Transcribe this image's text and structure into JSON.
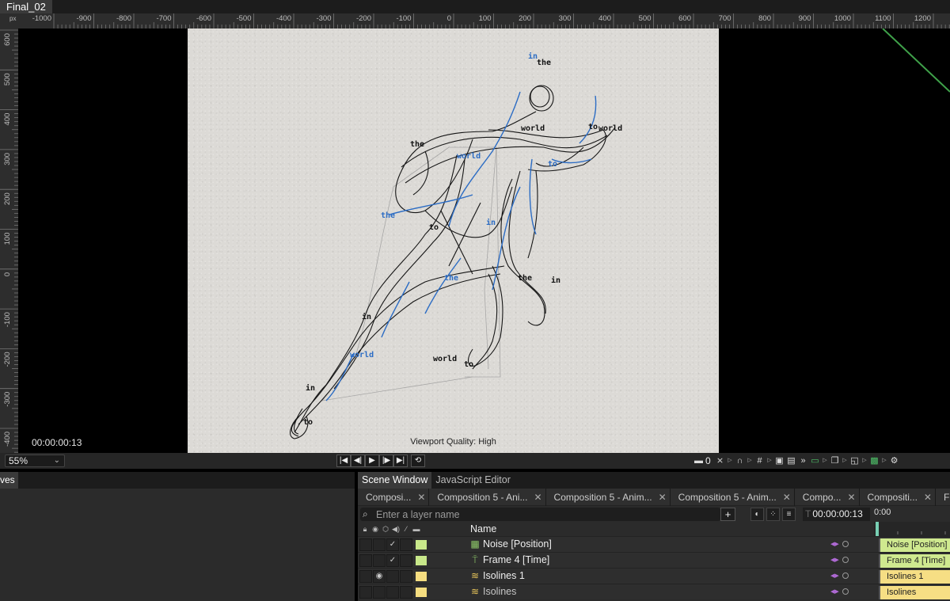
{
  "window": {
    "title": "Final_02"
  },
  "ruler": {
    "unit": "px",
    "x_labels": [
      "-1000",
      "-900",
      "-800",
      "-700",
      "-600",
      "-500",
      "-400",
      "-300",
      "-200",
      "-100",
      "0",
      "100",
      "200",
      "300",
      "400",
      "500",
      "600",
      "700",
      "800",
      "900",
      "1000",
      "1100",
      "1200"
    ],
    "y_labels": [
      "600",
      "500",
      "400",
      "300",
      "200",
      "100",
      "0",
      "-100",
      "-200",
      "-300",
      "-400"
    ]
  },
  "viewport": {
    "timecode": "00:00:00:13",
    "quality": "Viewport Quality: High",
    "words": [
      {
        "text": "in",
        "blue": true
      },
      {
        "text": "the",
        "blue": false
      },
      {
        "text": "world",
        "blue": false
      },
      {
        "text": "to",
        "blue": false
      },
      {
        "text": "world",
        "blue": false
      },
      {
        "text": "the",
        "blue": false
      },
      {
        "text": "world",
        "blue": true
      },
      {
        "text": "to",
        "blue": true
      },
      {
        "text": "the",
        "blue": true
      },
      {
        "text": "to",
        "blue": false
      },
      {
        "text": "in",
        "blue": true
      },
      {
        "text": "the",
        "blue": true
      },
      {
        "text": "the",
        "blue": false
      },
      {
        "text": "in",
        "blue": false
      },
      {
        "text": "in",
        "blue": false
      },
      {
        "text": "world",
        "blue": true
      },
      {
        "text": "world",
        "blue": false
      },
      {
        "text": "to",
        "blue": false
      },
      {
        "text": "in",
        "blue": false
      },
      {
        "text": "to",
        "blue": false
      }
    ]
  },
  "toolbar": {
    "zoom": "55%",
    "counter": "0"
  },
  "left_panel": {
    "tab": "ves"
  },
  "panel_tabs": [
    "Scene Window",
    "JavaScript Editor"
  ],
  "comp_tabs": [
    "Composi...",
    "Composition 5 - Ani...",
    "Composition 5 - Anim...",
    "Composition 5 - Anim...",
    "Compo...",
    "Compositi...",
    "F"
  ],
  "layers_panel": {
    "search_placeholder": "Enter a layer name",
    "time": "00:00:00:13",
    "time_prefix": "T",
    "timeline_start": "0:00",
    "name_header": "Name",
    "layers": [
      {
        "name": "Noise [Position]",
        "bar": "Noise [Position]",
        "chip": "#c8e88a",
        "bar_color": "#cfe98f",
        "icon": "noise-icon",
        "icon_glyph": "▦",
        "icon_color": "#8fca6a",
        "checked": true,
        "visible": false
      },
      {
        "name": "Frame 4 [Time]",
        "bar": "Frame 4 [Time]",
        "chip": "#c8e88a",
        "bar_color": "#cfe98f",
        "icon": "frame-icon",
        "icon_glyph": "⍑",
        "icon_color": "#8fca6a",
        "checked": true,
        "visible": false
      },
      {
        "name": "Isolines 1",
        "bar": "Isolines 1",
        "chip": "#f5dd80",
        "bar_color": "#f6de84",
        "icon": "isolines-icon",
        "icon_glyph": "≋",
        "icon_color": "#e6c45a",
        "checked": false,
        "visible": true
      },
      {
        "name": "Isolines",
        "bar": "Isolines",
        "chip": "#f5dd80",
        "bar_color": "#f6de84",
        "icon": "isolines-icon",
        "icon_glyph": "≋",
        "icon_color": "#e6c45a",
        "checked": false,
        "visible": false
      }
    ]
  },
  "colors": {
    "accent_green": "#3fa14a",
    "stroke_blue": "#2b6cc4",
    "playhead": "#78d0b4"
  }
}
